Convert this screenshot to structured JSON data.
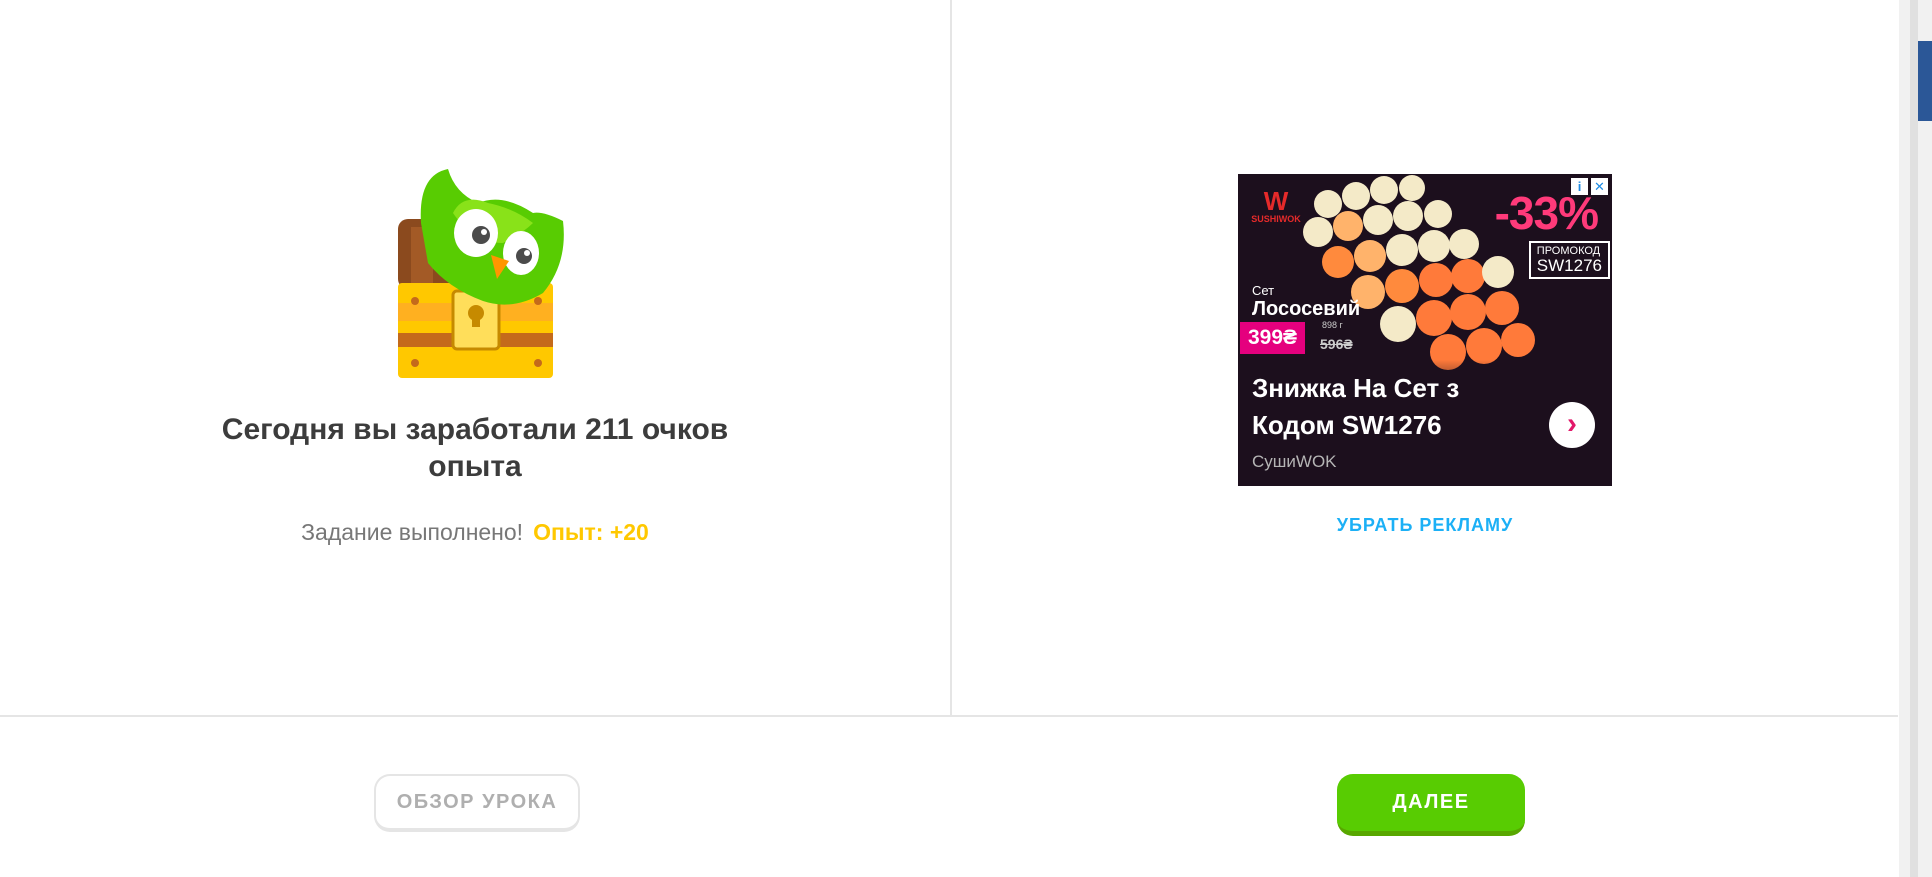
{
  "result": {
    "headline": "Сегодня вы заработали 211 очков опыта",
    "task_text": "Задание выполнено!",
    "xp_text": "Опыт: +20"
  },
  "ad": {
    "brand": "SUSHIWOK",
    "discount": "-33%",
    "promo_label": "ПРОМОКОД",
    "promo_code": "SW1276",
    "set_label": "Сет",
    "set_name": "Лососевий",
    "price": "399₴",
    "weight": "898 г",
    "old_price": "596₴",
    "title": "Знижка На Сет з Кодом SW1276",
    "advertiser": "СушиWOK",
    "info_icon": "i",
    "close_icon": "✕",
    "arrow_icon": "›"
  },
  "remove_ads_label": "УБРАТЬ РЕКЛАМУ",
  "footer": {
    "review_label": "ОБЗОР УРОКА",
    "next_label": "ДАЛЕЕ"
  },
  "colors": {
    "accent_green": "#58cc02",
    "xp_gold": "#ffc800",
    "link_blue": "#1cb0f6"
  }
}
